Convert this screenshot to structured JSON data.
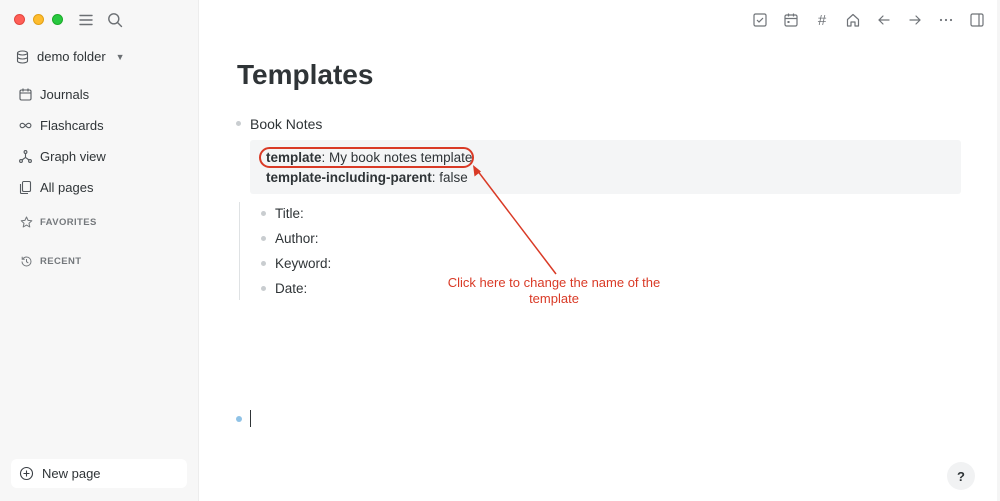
{
  "sidebar": {
    "folder_name": "demo folder",
    "items": [
      {
        "label": "Journals",
        "icon": "calendar-icon"
      },
      {
        "label": "Flashcards",
        "icon": "infinity-icon"
      },
      {
        "label": "Graph view",
        "icon": "graph-icon"
      },
      {
        "label": "All pages",
        "icon": "pages-icon"
      }
    ],
    "favorites_label": "FAVORITES",
    "recent_label": "RECENT",
    "new_page_label": "New page"
  },
  "toolbar": {
    "icons": [
      "checkbox-icon",
      "calendar-icon",
      "hashtag-icon",
      "home-icon",
      "arrow-left-icon",
      "arrow-right-icon",
      "more-icon",
      "sidebar-toggle-icon"
    ],
    "hashtag_glyph": "#"
  },
  "page": {
    "title": "Templates",
    "block": {
      "text": "Book Notes",
      "properties": [
        {
          "key": "template",
          "value": "My book notes template"
        },
        {
          "key": "template-including-parent",
          "value": "false"
        }
      ],
      "children": [
        "Title:",
        "Author:",
        "Keyword:",
        "Date:"
      ]
    }
  },
  "annotation": {
    "line1": "Click here to change the name of the",
    "line2": "template",
    "color": "#d93a26"
  },
  "help_label": "?",
  "colors": {
    "accent": "#d93a26",
    "sidebar_bg": "#f7f7f7",
    "props_bg": "#f4f5f6"
  }
}
